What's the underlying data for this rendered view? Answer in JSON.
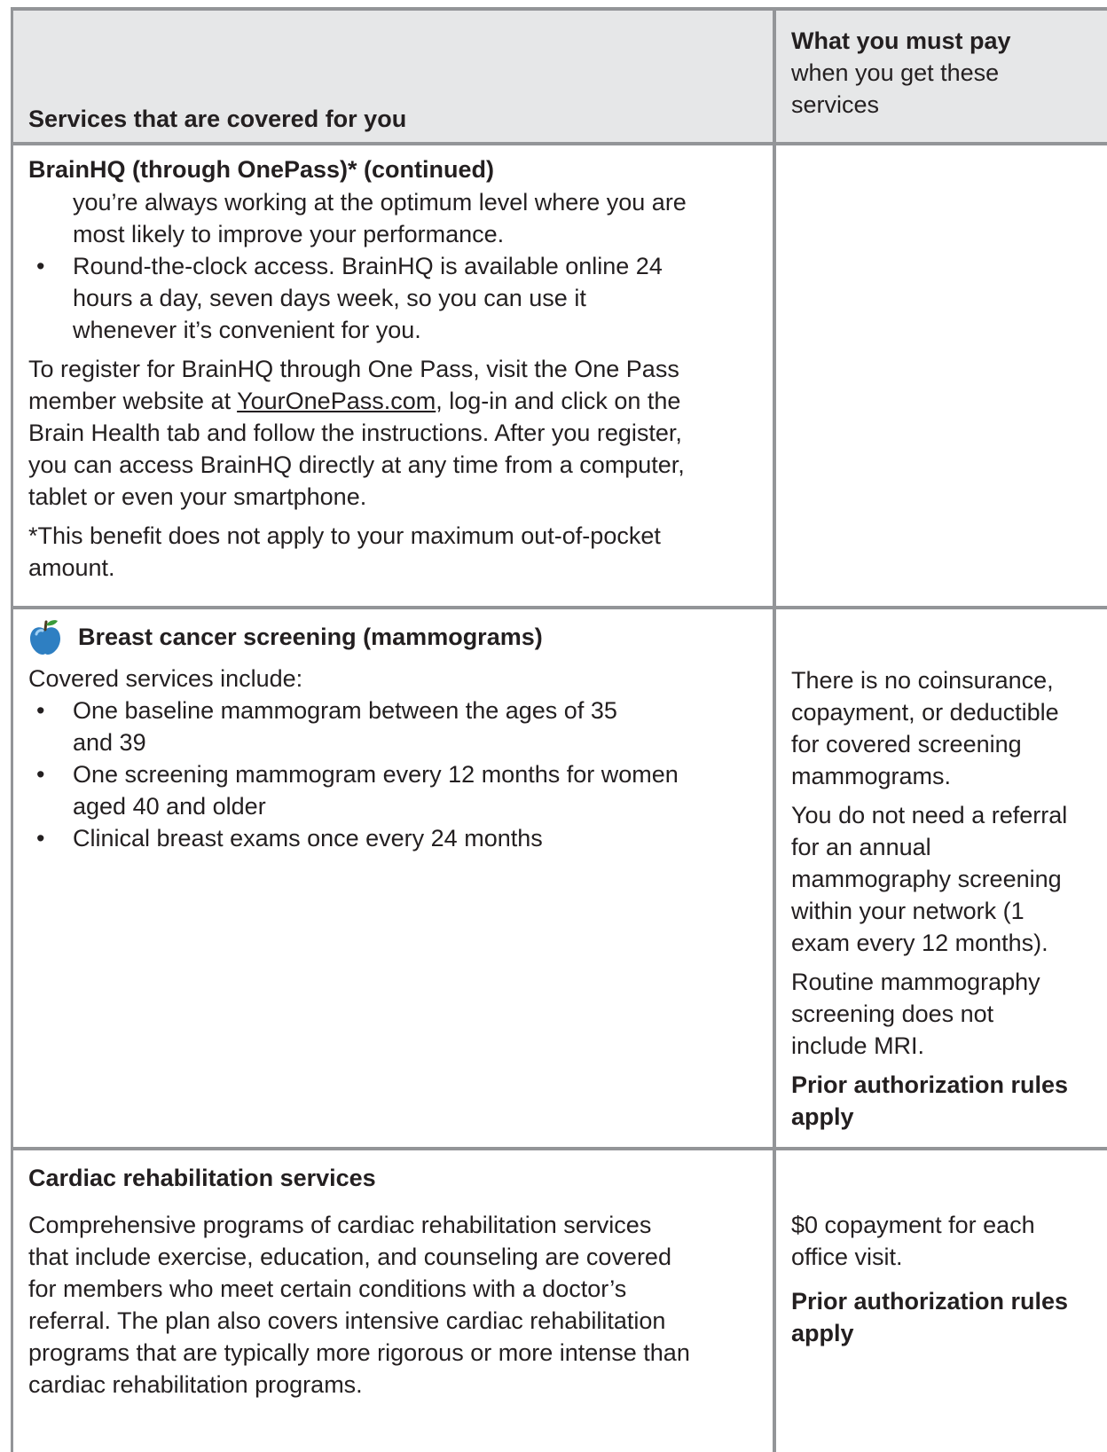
{
  "header": {
    "left": "Services that are covered for you",
    "right_bold": "What you must pay",
    "right_line1": "when you get these",
    "right_line2": "services"
  },
  "brainhq": {
    "title": "BrainHQ (through OnePass)* (continued)",
    "cont_line1": "you’re always working at the optimum level where you are",
    "cont_line2": "most likely to improve your performance.",
    "bullet_l1": "Round-the-clock access. BrainHQ is available online 24",
    "bullet_l2": "hours a day, seven days week, so you can use it",
    "bullet_l3": "whenever it’s convenient for you.",
    "reg_l1": "To register for BrainHQ through One Pass, visit the One Pass",
    "reg_l2_pre": "member website at ",
    "reg_link": "YourOnePass.com",
    "reg_l2_post": ", log-in and click on the",
    "reg_l3": "Brain Health tab and follow the instructions. After you register,",
    "reg_l4": "you can access BrainHQ directly at any time from a computer,",
    "reg_l5": "tablet or even your smartphone.",
    "note_l1": "*This benefit does not apply to your maximum out-of-pocket",
    "note_l2": "amount."
  },
  "breast": {
    "icon": "apple-icon",
    "title": "Breast cancer screening (mammograms)",
    "intro": "Covered services include:",
    "b1_l1": "One baseline mammogram between the ages of 35",
    "b1_l2": "and 39",
    "b2_l1": "One screening mammogram every 12 months for women",
    "b2_l2": "aged 40 and older",
    "b3": "Clinical breast exams once every 24 months",
    "pay_p1": [
      "There is no coinsurance,",
      "copayment, or deductible",
      "for covered screening",
      "mammograms."
    ],
    "pay_p2": [
      "You do not need a referral",
      "for an annual",
      "mammography screening",
      "within your network (1",
      "exam every 12 months)."
    ],
    "pay_p3": [
      "Routine mammography",
      "screening does not",
      "include MRI."
    ],
    "pay_bold": [
      "Prior authorization rules",
      "apply"
    ]
  },
  "cardiac": {
    "title": "Cardiac rehabilitation services",
    "body": [
      "Comprehensive programs of cardiac rehabilitation services",
      "that include exercise, education, and counseling are covered",
      "for members who meet certain conditions with a doctor’s",
      "referral. The plan also covers intensive cardiac rehabilitation",
      "programs that are typically more rigorous or more intense than",
      "cardiac rehabilitation programs."
    ],
    "pay_p1": [
      "$0 copayment for each",
      "office visit."
    ],
    "pay_bold": [
      "Prior authorization rules",
      "apply"
    ]
  },
  "bullet_char": "•",
  "colors": {
    "border": "#939598",
    "header_bg": "#e6e7e8",
    "text": "#231f20",
    "apple": "#2e7fc2"
  }
}
